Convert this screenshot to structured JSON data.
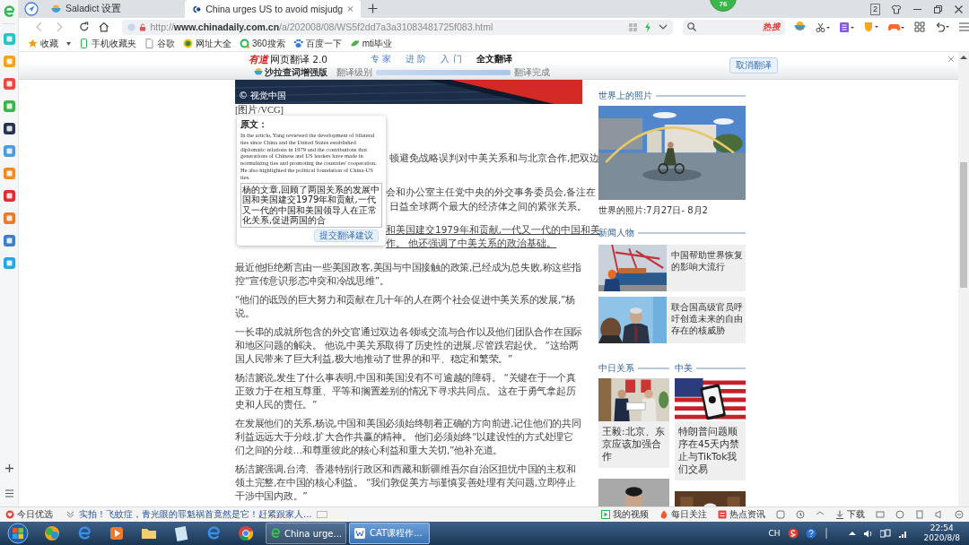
{
  "browser": {
    "tabs": [
      {
        "label": "Saladict 设置",
        "selected": false
      },
      {
        "label": "China urges US to avoid misjudg",
        "selected": true
      }
    ],
    "badge": "76",
    "window_count": "2",
    "url": {
      "scheme": "http://",
      "host": "www.chinadaily.com.cn",
      "path": "/a/202008/08/WS5f2dd7a3a31083481725f083.html"
    },
    "search_hint": "热搜",
    "bookmarks": [
      "收藏",
      "手机收藏夹",
      "谷歌",
      "网址大全",
      "360搜索",
      "百度一下",
      "mti毕业"
    ]
  },
  "translate_bar": {
    "brand": "有道",
    "title": "网页翻译 2.0",
    "subtitle": "沙拉查词增强版",
    "level_caption": "翻译级别",
    "levels": [
      {
        "label": "专 家",
        "selected": false
      },
      {
        "label": "进 阶",
        "selected": false
      },
      {
        "label": "入 门",
        "selected": false
      },
      {
        "label": "全文翻译",
        "selected": true
      }
    ],
    "progress": {
      "level": 1
    },
    "status": "翻译完成",
    "cancel": "取消翻译"
  },
  "article": {
    "image_credit": "© 视觉中国",
    "caption": "[图片/VCG]",
    "fragments": [
      {
        "text": "顿避免战略误判对中美关系和与北京合作,把双边",
        "link": false
      },
      {
        "text": "会和办公室主任党中央的外交事务委员会,备注在",
        "link": false
      },
      {
        "text": "日益全球两个最大的经济体之间的紧张关系。",
        "link": false
      },
      {
        "text": "和美国建交1979年和贡献,一代又一代的中国和美",
        "link": true
      },
      {
        "text": "作。 他还强调了中美关系的政治基础。",
        "link": true
      }
    ],
    "paragraphs": [
      "最近他拒绝断言由一些美国政客,美国与中国接触的政策,已经成为总失败,称这些指控“宣传意识形态冲突和冷战思维”。",
      "“他们的诋毁的巨大努力和贡献在几十年的人在两个社会促进中美关系的发展,”杨说。",
      "一长串的成就所包含的外交官通过双边各领域交流与合作以及他们团队合作在国际和地区问题的解决。 他说,中美关系取得了历史性的进展,尽管跌宕起伏。 “这给两国人民带来了巨大利益,极大地推动了世界的和平、稳定和繁荣。”",
      "杨洁篪说,发生了什么事表明,中国和美国没有不可逾越的障碍。 “关键在于一个真正致力于在相互尊重、平等和搁置差别的情况下寻求共同点。 这在于勇气拿起历史和人民的责任。”",
      "在发展他们的关系,杨说,中国和美国必须始终朝着正确的方向前进,记住他们的共同利益远远大于分歧,扩大合作共赢的精神。 他们必须始终“以建设性的方式处理它们之间的分歧…和尊重彼此的核心利益和重大关切,”他补充道。",
      "杨洁篪强调,台湾、香港特别行政区和西藏和新疆维吾尔自治区担忧中国的主权和领土完整,在中国的核心利益。 “我们敦促美方与谨慎妥善处理有关问题,立即停止干涉中国内政。”"
    ]
  },
  "popup": {
    "label": "原文：",
    "source": "In the article, Yang reviewed the development of bilateral ties since China and the United States established diplomatic relations in 1979 and the contributions that generations of Chinese and US leaders have made in normalizing ties and promoting the countries' cooperation. He also highlighted the political foundation of China-US ties.",
    "translation": "杨的文章,回顾了两国关系的发展中国和美国建交1979年和贡献,一代又一代的中国和美国领导人在正常化关系,促进两国的合",
    "submit": "提交翻译建议"
  },
  "sidebar": {
    "photo_title": "世界上的照片",
    "photo_caption": "世界的照片:7月27日- 8月2",
    "people_title": "新闻人物",
    "people": [
      "中国帮助世界恢复的影响大流行",
      "联合国高级官员呼吁创造未来的自由存在的核威胁"
    ],
    "columns": [
      {
        "title": "中日关系",
        "card": "王毅:北京、东京应该加强合作"
      },
      {
        "title": "中美",
        "card": "特朗普问题顺序在45天内禁止与TikTok我们交易"
      }
    ]
  },
  "status_bar": {
    "pick": "今日优选",
    "headline": "实拍！飞蚊症，青光眼的罪魁祸首竟然是它！赶紧跟家人...",
    "links": [
      "我的视频",
      "每日关注",
      "热点资讯"
    ],
    "download": "下载"
  },
  "taskbar": {
    "windows": [
      {
        "label": "China urge...",
        "selected": false
      },
      {
        "label": "CAT课程作...",
        "selected": true
      }
    ],
    "language": "CH",
    "time": "22:54",
    "date": "2020/8/8"
  }
}
